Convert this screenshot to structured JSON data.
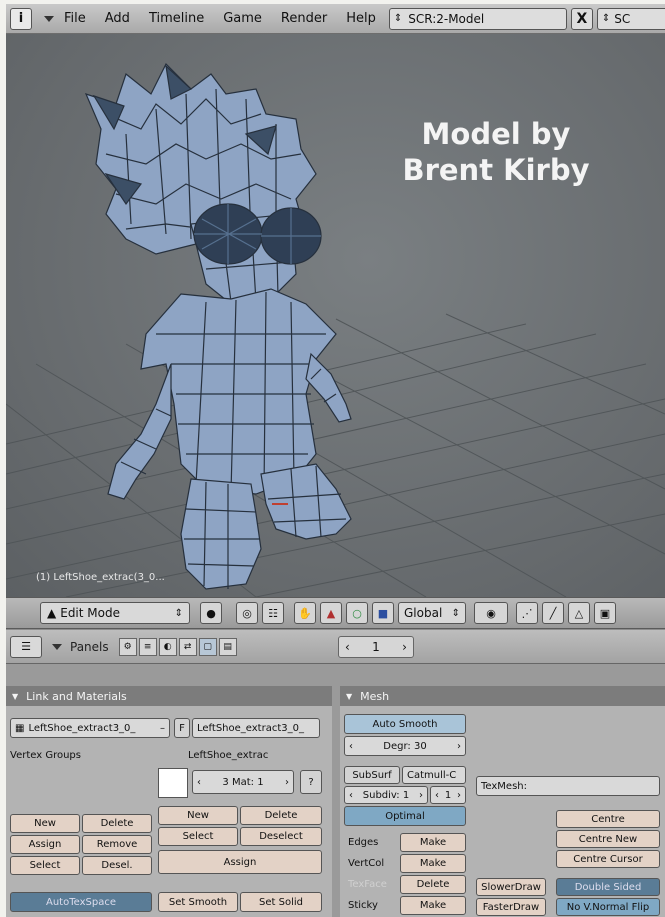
{
  "menubar": {
    "editor_icon": "i",
    "menus": [
      "File",
      "Add",
      "Timeline",
      "Game",
      "Render",
      "Help"
    ],
    "scene_name": "SCR:2-Model",
    "close_glyph": "X",
    "next_scene": "SC"
  },
  "viewport": {
    "credit_line1": "Model by",
    "credit_line2": "Brent Kirby",
    "object_label": "(1) LeftShoe_extrac(3_0..."
  },
  "view_header": {
    "mode": "Edit Mode",
    "orientation": "Global"
  },
  "buttons_header": {
    "panels_label": "Panels",
    "page_value": "1"
  },
  "link_panel": {
    "title": "Link and Materials",
    "mesh_name": "LeftShoe_extract3_0_",
    "f_label": "F",
    "ob_name": "LeftShoe_extract3_0_",
    "vertex_groups_label": "Vertex Groups",
    "material_name": "LeftShoe_extrac",
    "mat_counter": "3 Mat: 1",
    "mat_q": "?",
    "new": "New",
    "delete": "Delete",
    "assign": "Assign",
    "remove": "Remove",
    "select": "Select",
    "deselect": "Desel.",
    "mat_new": "New",
    "mat_delete": "Delete",
    "mat_select": "Select",
    "mat_deselect": "Deselect",
    "mat_assign": "Assign",
    "autotex": "AutoTexSpace",
    "set_smooth": "Set Smooth",
    "set_solid": "Set Solid"
  },
  "mesh_panel": {
    "title": "Mesh",
    "auto_smooth": "Auto Smooth",
    "degr": "Degr: 30",
    "subsurf": "SubSurf",
    "catmull": "Catmull-C",
    "subdiv": "Subdiv: 1",
    "subdiv_r": "1",
    "optimal": "Optimal",
    "texmesh": "TexMesh:",
    "edges": "Edges",
    "vertcol": "VertCol",
    "texface": "TexFace",
    "sticky": "Sticky",
    "make": "Make",
    "delete": "Delete",
    "centre": "Centre",
    "centre_new": "Centre New",
    "centre_cursor": "Centre Cursor",
    "slowerdraw": "SlowerDraw",
    "fasterdraw": "FasterDraw",
    "double_sided": "Double Sided",
    "no_vnormal_flip": "No V.Normal Flip"
  },
  "colors": {
    "viewport_bg": "#6a6e71",
    "mesh_fill": "#8ea4c4",
    "mesh_wire": "#26303d",
    "button_salmon": "#e3d2c6",
    "button_blue": "#7fa8c4"
  }
}
